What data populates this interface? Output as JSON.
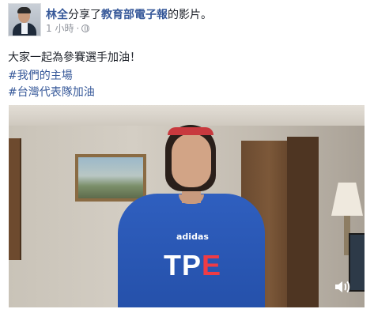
{
  "post": {
    "author": "林全",
    "action": "分享了",
    "source_page": "教育部電子報",
    "suffix": "的影片。",
    "time": "1 小時",
    "separator": "·",
    "privacy_icon": "globe-icon"
  },
  "caption": "大家一起為參賽選手加油！",
  "hashtags": [
    "#我們的主場",
    "#台灣代表隊加油"
  ],
  "video": {
    "shirt_brand": "adidas",
    "shirt_text_main": "TP",
    "shirt_text_accent": "E",
    "speaker_icon": "speaker-icon"
  },
  "colors": {
    "link": "#365899",
    "meta": "#90949c",
    "text": "#1d2129",
    "shirt": "#2f5fbf",
    "accent": "#ef3b45"
  }
}
